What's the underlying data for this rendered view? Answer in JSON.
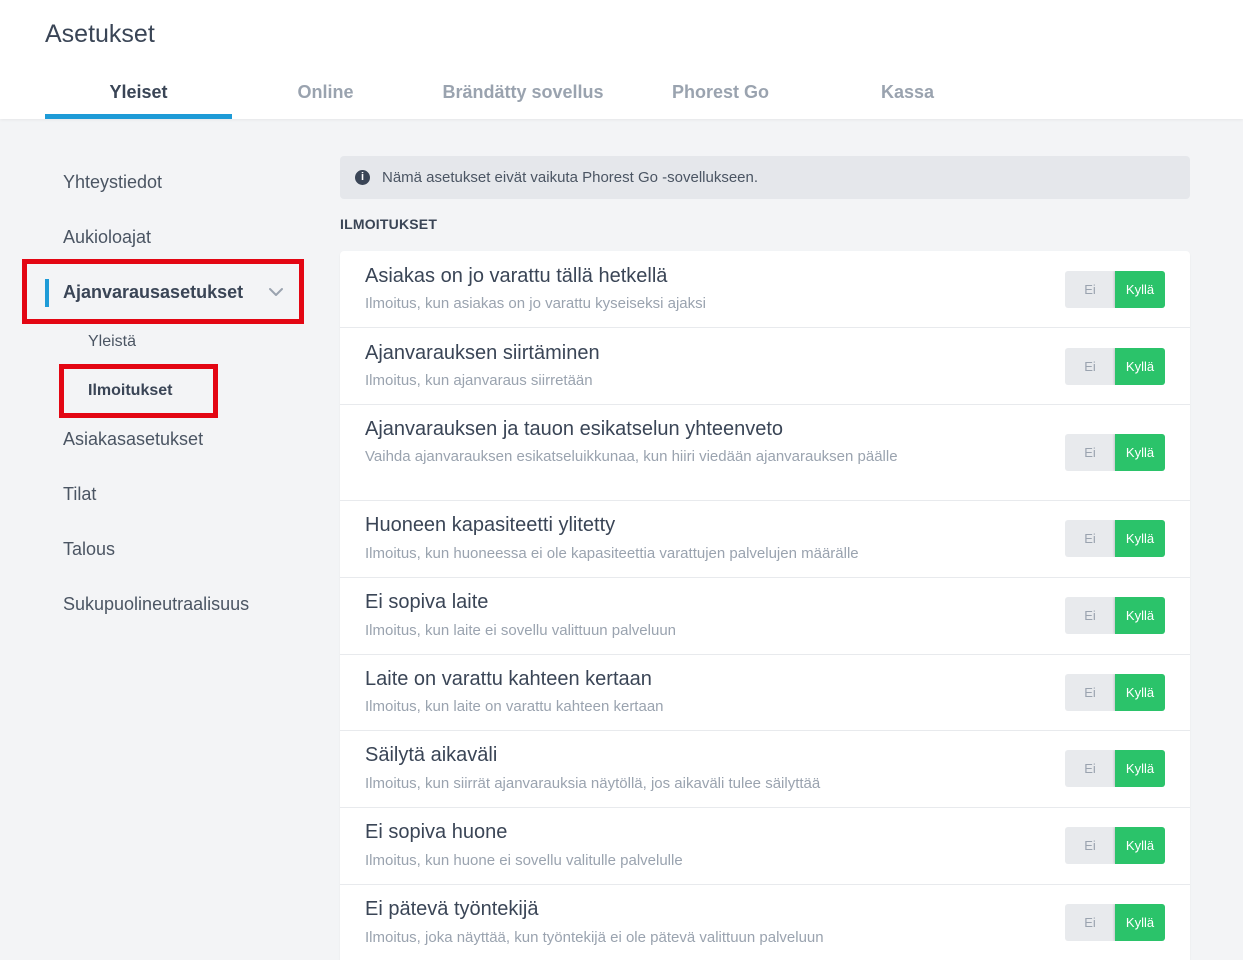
{
  "page": {
    "title": "Asetukset"
  },
  "tabs": [
    {
      "label": "Yleiset",
      "active": true
    },
    {
      "label": "Online"
    },
    {
      "label": "Brändätty sovellus"
    },
    {
      "label": "Phorest Go"
    },
    {
      "label": "Kassa"
    }
  ],
  "sidebar": {
    "items": [
      {
        "label": "Yhteystiedot"
      },
      {
        "label": "Aukioloajat"
      },
      {
        "label": "Ajanvarausasetukset",
        "expanded": true
      },
      {
        "label": "Asiakasasetukset"
      },
      {
        "label": "Tilat"
      },
      {
        "label": "Talous"
      },
      {
        "label": "Sukupuolineutraalisuus"
      }
    ],
    "subitems": [
      {
        "label": "Yleistä"
      },
      {
        "label": "Ilmoitukset",
        "active": true
      }
    ]
  },
  "info": {
    "icon": "info-icon",
    "text": "Nämä asetukset eivät vaikuta Phorest Go -sovellukseen."
  },
  "section": {
    "title": "ILMOITUKSET"
  },
  "toggle": {
    "off_label": "Ei",
    "on_label": "Kyllä"
  },
  "settings": [
    {
      "title": "Asiakas on jo varattu tällä hetkellä",
      "description": "Ilmoitus, kun asiakas on jo varattu kyseiseksi ajaksi",
      "value": "Kyllä"
    },
    {
      "title": "Ajanvarauksen siirtäminen",
      "description": "Ilmoitus, kun ajanvaraus siirretään",
      "value": "Kyllä"
    },
    {
      "title": "Ajanvarauksen ja tauon esikatselun yhteenveto",
      "description": "Vaihda ajanvarauksen esikatseluikkunaa, kun hiiri viedään ajanvarauksen päälle",
      "value": "Kyllä"
    },
    {
      "title": "Huoneen kapasiteetti ylitetty",
      "description": "Ilmoitus, kun huoneessa ei ole kapasiteettia varattujen palvelujen määrälle",
      "value": "Kyllä"
    },
    {
      "title": "Ei sopiva laite",
      "description": "Ilmoitus, kun laite ei sovellu valittuun palveluun",
      "value": "Kyllä"
    },
    {
      "title": "Laite on varattu kahteen kertaan",
      "description": "Ilmoitus, kun laite on varattu kahteen kertaan",
      "value": "Kyllä"
    },
    {
      "title": "Säilytä aikaväli",
      "description": "Ilmoitus, kun siirrät ajanvarauksia näytöllä, jos aikaväli tulee säilyttää",
      "value": "Kyllä"
    },
    {
      "title": "Ei sopiva huone",
      "description": "Ilmoitus, kun huone ei sovellu valitulle palvelulle",
      "value": "Kyllä"
    },
    {
      "title": "Ei pätevä työntekijä",
      "description": "Ilmoitus, joka näyttää, kun työntekijä ei ole pätevä valittuun palveluun",
      "value": "Kyllä"
    }
  ],
  "colors": {
    "accent": "#1e9bd7",
    "toggle_on": "#2bc36a",
    "highlight": "#e30613"
  }
}
